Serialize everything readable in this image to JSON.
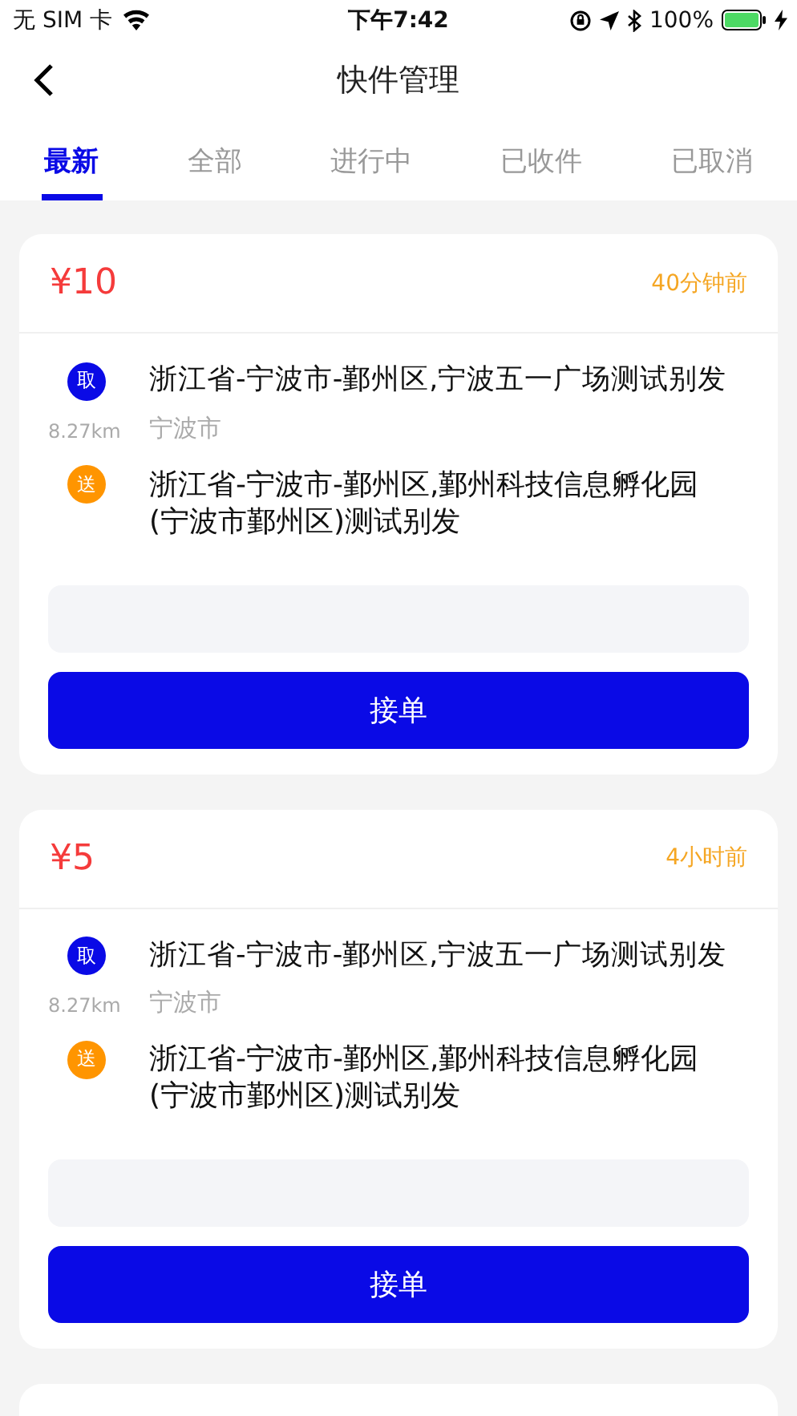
{
  "status_bar": {
    "carrier": "无 SIM 卡",
    "time": "下午7:42",
    "battery": "100%"
  },
  "nav": {
    "title": "快件管理"
  },
  "tabs": [
    {
      "label": "最新",
      "selected": true
    },
    {
      "label": "全部",
      "selected": false
    },
    {
      "label": "进行中",
      "selected": false
    },
    {
      "label": "已收件",
      "selected": false
    },
    {
      "label": "已取消",
      "selected": false
    }
  ],
  "orders": [
    {
      "price": "¥10",
      "time_ago": "40分钟前",
      "stops": [
        {
          "kind": "pickup",
          "badge": "取",
          "address": "浙江省-宁波市-鄞州区,宁波五一广场测试别发",
          "distance": "8.27km",
          "city": "宁波市"
        },
        {
          "kind": "dropoff",
          "badge": "送",
          "address": "浙江省-宁波市-鄞州区,鄞州科技信息孵化园(宁波市鄞州区)测试别发"
        }
      ],
      "button": "接单"
    },
    {
      "price": "¥5",
      "time_ago": "4小时前",
      "stops": [
        {
          "kind": "pickup",
          "badge": "取",
          "address": "浙江省-宁波市-鄞州区,宁波五一广场测试别发",
          "distance": "8.27km",
          "city": "宁波市"
        },
        {
          "kind": "dropoff",
          "badge": "送",
          "address": "浙江省-宁波市-鄞州区,鄞州科技信息孵化园(宁波市鄞州区)测试别发"
        }
      ],
      "button": "接单"
    }
  ]
}
